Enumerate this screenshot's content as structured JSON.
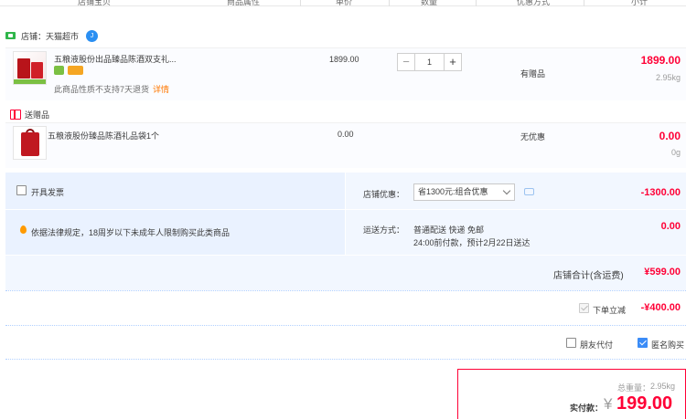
{
  "header": {
    "col_info": "店铺宝贝",
    "col_attr": "商品属性",
    "col_price": "单价",
    "col_qty": "数量",
    "col_promo": "优惠方式",
    "col_subtotal": "小计"
  },
  "shop": {
    "label": "店铺：天猫超市"
  },
  "items": [
    {
      "title": "五粮液股份出品臻品陈酒双支礼...",
      "warning": "此商品性质不支持7天退货",
      "detail_link": "详情",
      "price": "1899.00",
      "quantity": "1",
      "promo": "有赠品",
      "subtotal": "1899.00",
      "weight": "2.95kg"
    }
  ],
  "gift": {
    "label": "送赠品",
    "title": "五粮液股份臻品陈酒礼品袋1个",
    "price": "0.00",
    "promo": "无优惠",
    "subtotal": "0.00",
    "weight": "0g"
  },
  "options": {
    "invoice_label": "开具发票",
    "legal_notice": "依据法律规定，18周岁以下未成年人限制购买此类商品",
    "store_discount_label": "店铺优惠：",
    "store_discount_select": "省1300元:组合优惠",
    "store_discount_amount": "-1300.00",
    "delivery_label": "运送方式：",
    "delivery_method": "普通配送 快递 免邮",
    "delivery_time": "24:00前付款，预计2月22日送达",
    "delivery_amount": "0.00"
  },
  "store_total": {
    "label": "店铺合计(含运费)",
    "amount": "¥599.00"
  },
  "instant_discount": {
    "label": "下单立减",
    "amount": "-¥400.00"
  },
  "extras": {
    "friend_pay_label": "朋友代付",
    "anonymous_label": "匿名购买"
  },
  "summary": {
    "weight_label": "总重量：",
    "weight": "2.95kg",
    "pay_label": "实付款：",
    "currency": "¥",
    "amount": "199.00"
  },
  "colors": {
    "accent_red": "#ff0036",
    "link_orange": "#ff7700",
    "panel_blue": "#f2f7ff",
    "check_blue": "#3b8cf7"
  }
}
